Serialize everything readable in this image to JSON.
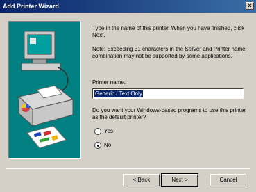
{
  "window": {
    "title": "Add Printer Wizard"
  },
  "content": {
    "instruction": "Type in the name of this printer. When you have finished, click Next.",
    "note": "Note: Exceeding 31 characters in the Server and Printer name combination may not be supported by some applications.",
    "printer_name_label": "Printer name:",
    "printer_name_value": "Generic / Text Only",
    "default_question": "Do you want your Windows-based programs to use this printer as the default printer?",
    "options": [
      {
        "label": "Yes",
        "selected": false
      },
      {
        "label": "No",
        "selected": true
      }
    ]
  },
  "buttons": {
    "back": "< Back",
    "next": "Next >",
    "cancel": "Cancel"
  },
  "icons": {
    "close": "close-icon",
    "wizard_art": "computer-printer-illustration"
  }
}
